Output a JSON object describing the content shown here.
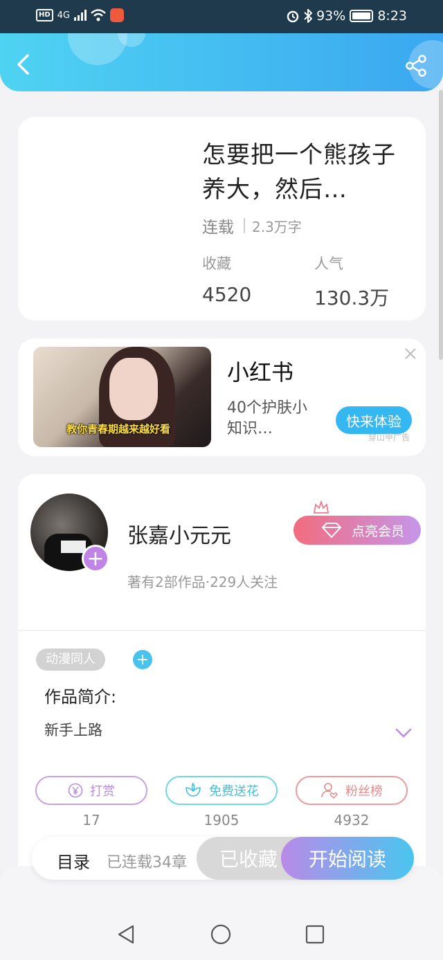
{
  "status_bar": {
    "network": "4G",
    "hd": "HD",
    "battery": "93%",
    "time": "8:23"
  },
  "header": {
    "back_icon": "chevron-left-icon",
    "share_icon": "share-icon"
  },
  "book": {
    "title": "怎要把一个熊孩子养大，然后…",
    "status": "连载",
    "word_count": "2.3万字",
    "favorites_label": "收藏",
    "favorites_value": "4520",
    "popularity_label": "人气",
    "popularity_value": "130.3万"
  },
  "ad": {
    "image_caption": "教你青春期越来越好看",
    "title": "小红书",
    "description": "40个护肤小知识…",
    "cta": "快来体验",
    "source": "穿山甲广告"
  },
  "author": {
    "name": "张嘉小元元",
    "info": "著有2部作品·229人关注",
    "member_button": "点亮会员",
    "follow_plus": "+"
  },
  "work": {
    "genre_tag": "动漫同人",
    "add_tag": "+",
    "intro_label": "作品简介:",
    "intro_text": "新手上路"
  },
  "actions": [
    {
      "label": "打赏",
      "count": "17",
      "icon": "yen-icon"
    },
    {
      "label": "免费送花",
      "count": "1905",
      "icon": "flower-icon"
    },
    {
      "label": "粉丝榜",
      "count": "4932",
      "icon": "user-heart-icon"
    }
  ],
  "bottom_bar": {
    "catalog": "目录",
    "serial": "已连载34章",
    "collected": "已收藏",
    "read": "开始阅读"
  },
  "colors": {
    "header_start": "#4fd3f2",
    "header_end": "#3aa7f0",
    "accent_purple": "#c184e6",
    "accent_blue": "#49c6ef"
  }
}
